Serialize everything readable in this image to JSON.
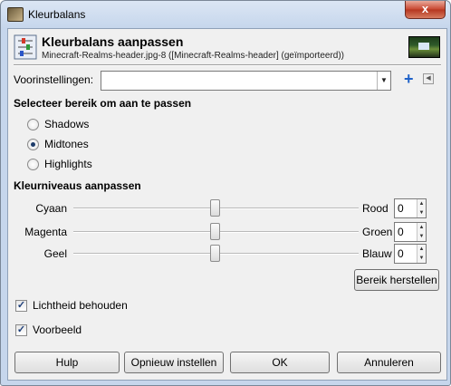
{
  "window": {
    "title": "Kleurbalans",
    "close_label": "x"
  },
  "header": {
    "title": "Kleurbalans aanpassen",
    "subtitle": "Minecraft-Realms-header.jpg-8 ([Minecraft-Realms-header] (geïmporteerd))"
  },
  "presets": {
    "label": "Voorinstellingen:",
    "value": ""
  },
  "range": {
    "heading": "Selecteer bereik om aan te passen",
    "options": [
      {
        "label": "Shadows",
        "selected": false
      },
      {
        "label": "Midtones",
        "selected": true
      },
      {
        "label": "Highlights",
        "selected": false
      }
    ]
  },
  "levels": {
    "heading": "Kleurniveaus aanpassen",
    "rows": [
      {
        "left": "Cyaan",
        "right": "Rood",
        "value": "0"
      },
      {
        "left": "Magenta",
        "right": "Groen",
        "value": "0"
      },
      {
        "left": "Geel",
        "right": "Blauw",
        "value": "0"
      }
    ],
    "reset_button": "Bereik herstellen"
  },
  "options": {
    "preserve_luminosity": {
      "label": "Lichtheid behouden",
      "checked": true
    },
    "preview": {
      "label": "Voorbeeld",
      "checked": true
    }
  },
  "buttons": {
    "help": "Hulp",
    "reset": "Opnieuw instellen",
    "ok": "OK",
    "cancel": "Annuleren"
  }
}
